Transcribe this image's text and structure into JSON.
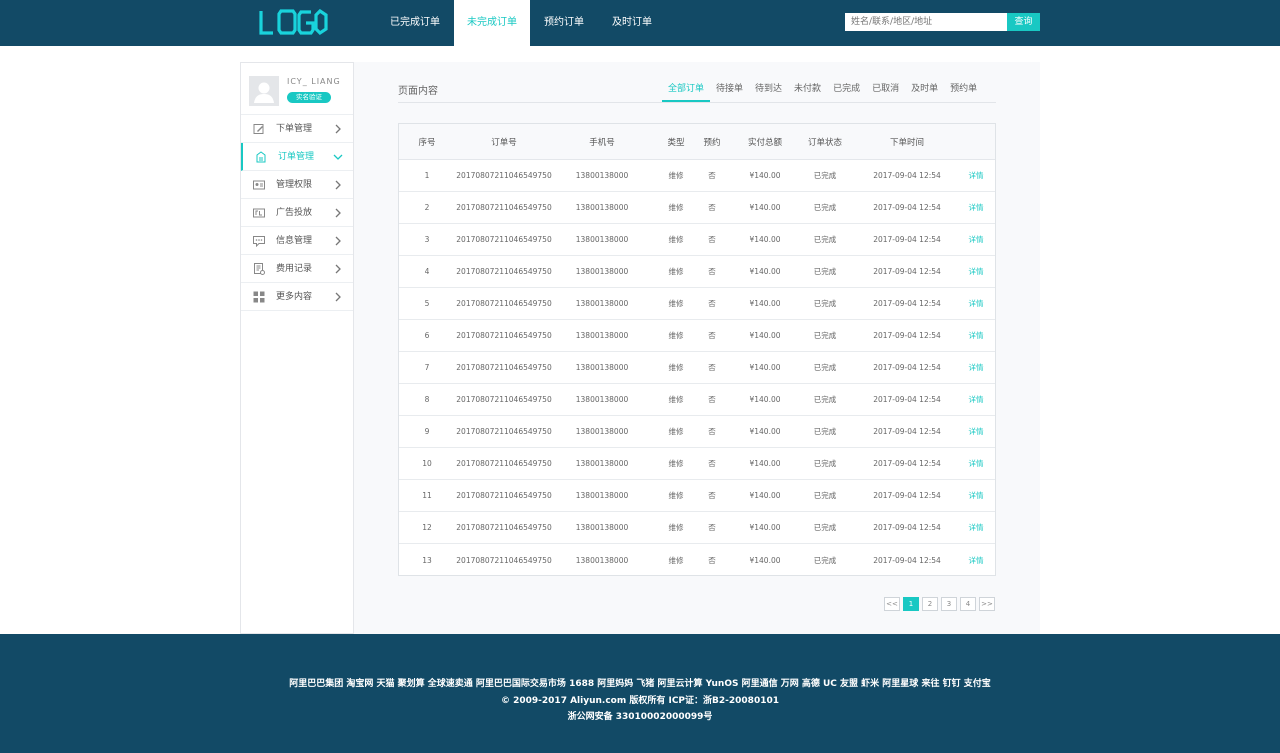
{
  "header": {
    "logo_text": "LOGO",
    "tabs": [
      {
        "label": "已完成订单"
      },
      {
        "label": "未完成订单"
      },
      {
        "label": "预约订单"
      },
      {
        "label": "及时订单"
      }
    ],
    "search_placeholder": "姓名/联系/地区/地址",
    "search_button": "查询"
  },
  "sidebar": {
    "username": "ICY_ LIANG",
    "badge": "实名验证",
    "items": [
      {
        "label": "下单管理",
        "icon": "edit-icon"
      },
      {
        "label": "订单管理",
        "icon": "order-icon"
      },
      {
        "label": "管理权限",
        "icon": "id-card-icon"
      },
      {
        "label": "广告投放",
        "icon": "ad-icon"
      },
      {
        "label": "信息管理",
        "icon": "message-icon"
      },
      {
        "label": "费用记录",
        "icon": "receipt-icon"
      },
      {
        "label": "更多内容",
        "icon": "grid-icon"
      }
    ]
  },
  "main": {
    "title": "页面内容",
    "filters": [
      "全部订单",
      "待接单",
      "待到达",
      "未付款",
      "已完成",
      "已取消",
      "及时单",
      "预约单"
    ],
    "columns": [
      "序号",
      "订单号",
      "手机号",
      "类型",
      "预约",
      "实付总额",
      "订单状态",
      "下单时间"
    ],
    "rows": [
      {
        "seq": "1",
        "order": "20170807211046549750",
        "phone": "13800138000",
        "type": "维修",
        "reserve": "否",
        "amount": "¥140.00",
        "status": "已完成",
        "time": "2017-09-04  12:54",
        "action": "详情"
      },
      {
        "seq": "2",
        "order": "20170807211046549750",
        "phone": "13800138000",
        "type": "维修",
        "reserve": "否",
        "amount": "¥140.00",
        "status": "已完成",
        "time": "2017-09-04  12:54",
        "action": "详情"
      },
      {
        "seq": "3",
        "order": "20170807211046549750",
        "phone": "13800138000",
        "type": "维修",
        "reserve": "否",
        "amount": "¥140.00",
        "status": "已完成",
        "time": "2017-09-04  12:54",
        "action": "详情"
      },
      {
        "seq": "4",
        "order": "20170807211046549750",
        "phone": "13800138000",
        "type": "维修",
        "reserve": "否",
        "amount": "¥140.00",
        "status": "已完成",
        "time": "2017-09-04  12:54",
        "action": "详情"
      },
      {
        "seq": "5",
        "order": "20170807211046549750",
        "phone": "13800138000",
        "type": "维修",
        "reserve": "否",
        "amount": "¥140.00",
        "status": "已完成",
        "time": "2017-09-04  12:54",
        "action": "详情"
      },
      {
        "seq": "6",
        "order": "20170807211046549750",
        "phone": "13800138000",
        "type": "维修",
        "reserve": "否",
        "amount": "¥140.00",
        "status": "已完成",
        "time": "2017-09-04  12:54",
        "action": "详情"
      },
      {
        "seq": "7",
        "order": "20170807211046549750",
        "phone": "13800138000",
        "type": "维修",
        "reserve": "否",
        "amount": "¥140.00",
        "status": "已完成",
        "time": "2017-09-04  12:54",
        "action": "详情"
      },
      {
        "seq": "8",
        "order": "20170807211046549750",
        "phone": "13800138000",
        "type": "维修",
        "reserve": "否",
        "amount": "¥140.00",
        "status": "已完成",
        "time": "2017-09-04  12:54",
        "action": "详情"
      },
      {
        "seq": "9",
        "order": "20170807211046549750",
        "phone": "13800138000",
        "type": "维修",
        "reserve": "否",
        "amount": "¥140.00",
        "status": "已完成",
        "time": "2017-09-04  12:54",
        "action": "详情"
      },
      {
        "seq": "10",
        "order": "20170807211046549750",
        "phone": "13800138000",
        "type": "维修",
        "reserve": "否",
        "amount": "¥140.00",
        "status": "已完成",
        "time": "2017-09-04  12:54",
        "action": "详情"
      },
      {
        "seq": "11",
        "order": "20170807211046549750",
        "phone": "13800138000",
        "type": "维修",
        "reserve": "否",
        "amount": "¥140.00",
        "status": "已完成",
        "time": "2017-09-04  12:54",
        "action": "详情"
      },
      {
        "seq": "12",
        "order": "20170807211046549750",
        "phone": "13800138000",
        "type": "维修",
        "reserve": "否",
        "amount": "¥140.00",
        "status": "已完成",
        "time": "2017-09-04  12:54",
        "action": "详情"
      },
      {
        "seq": "13",
        "order": "20170807211046549750",
        "phone": "13800138000",
        "type": "维修",
        "reserve": "否",
        "amount": "¥140.00",
        "status": "已完成",
        "time": "2017-09-04  12:54",
        "action": "详情"
      }
    ],
    "pagination": {
      "prev": "<<",
      "pages": [
        "1",
        "2",
        "3",
        "4"
      ],
      "next": ">>",
      "current": "1"
    }
  },
  "footer": {
    "links": "阿里巴巴集团 淘宝网 天猫 聚划算 全球速卖通 阿里巴巴国际交易市场 1688 阿里妈妈 飞猪 阿里云计算 YunOS 阿里通信 万网 高德 UC 友盟 虾米 阿里星球 来往 钉钉 支付宝",
    "copyright": "© 2009-2017 Aliyun.com 版权所有 ICP证：浙B2-20080101",
    "beian": "浙公网安备 33010002000099号"
  },
  "colors": {
    "header_bg": "#124a66",
    "accent": "#19c8c3",
    "footer_bg": "#124a66"
  }
}
